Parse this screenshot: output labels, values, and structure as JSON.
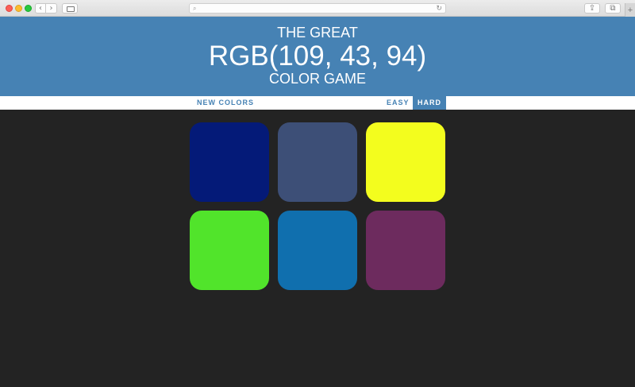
{
  "browser": {
    "back_icon": "‹",
    "forward_icon": "›",
    "search_icon": "⌕",
    "reload_icon": "↻",
    "share_icon": "⇪",
    "tabs_icon": "⧉",
    "new_tab_icon": "+"
  },
  "header": {
    "line1": "THE GREAT",
    "target_color": "RGB(109, 43, 94)",
    "line3": "COLOR GAME"
  },
  "controls": {
    "new_colors": "NEW COLORS",
    "easy": "EASY",
    "hard": "HARD",
    "selected_mode": "hard"
  },
  "colors": {
    "header_bg": "#4682b4",
    "body_bg": "#232323"
  },
  "squares": [
    "#041a78",
    "#3d4f77",
    "#f3fd1e",
    "#51e42b",
    "#106fae",
    "#6d2b5e"
  ]
}
